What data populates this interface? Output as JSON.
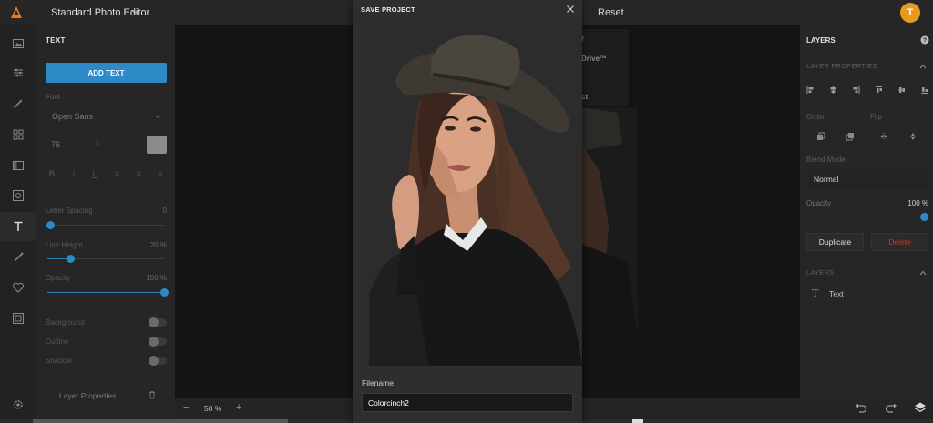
{
  "app": {
    "title": "Standard Photo Editor",
    "reset_label": "Reset",
    "user_initial": "T"
  },
  "rail": {
    "icons": [
      "image-icon",
      "adjust-icon",
      "wand-icon",
      "grid-icon",
      "frame-icon",
      "focus-icon",
      "text-icon",
      "brush-icon",
      "heart-icon",
      "border-icon",
      "settings-icon"
    ],
    "active": "text-icon"
  },
  "left_panel": {
    "title": "TEXT",
    "add_text_label": "ADD TEXT",
    "font_label": "Font",
    "font_value": "Open Sans",
    "size_value": "76",
    "format_buttons": [
      "B",
      "I",
      "U",
      "≡",
      "≡",
      "≡"
    ],
    "letter_spacing": {
      "label": "Letter Spacing",
      "value": "0",
      "fraction": 0.03
    },
    "line_height": {
      "label": "Line Height",
      "value": "20 %",
      "fraction": 0.2
    },
    "opacity": {
      "label": "Opacity",
      "value": "100 %",
      "fraction": 1.0
    },
    "toggles": [
      "Background",
      "Outline",
      "Shadow"
    ],
    "layer_properties_label": "Layer Properties"
  },
  "canvas": {
    "ghost_menu": [
      "r",
      "Drive™",
      "ct"
    ]
  },
  "bottom_bar": {
    "zoom_minus": "−",
    "zoom_value": "50 %",
    "zoom_plus": "+"
  },
  "right_panel": {
    "title": "LAYERS",
    "layer_properties_title": "LAYER PROPERTIES",
    "order_label": "Order",
    "flip_label": "Flip",
    "blend_mode_label": "Blend Mode",
    "blend_mode_value": "Normal",
    "opacity_label": "Opacity",
    "opacity_value": "100 %",
    "opacity_fraction": 1.0,
    "duplicate_label": "Duplicate",
    "delete_label": "Delete",
    "layers_section": "LAYERS",
    "layers": [
      {
        "icon": "T",
        "name": "Text"
      }
    ]
  },
  "modal": {
    "title": "SAVE PROJECT",
    "filename_label": "Filename",
    "filename_value": "Colorcinch2"
  },
  "colors": {
    "accent": "#2d8ac6",
    "delete": "#c0392b",
    "avatar": "#e89a1e",
    "logo": "#f07a1a"
  }
}
